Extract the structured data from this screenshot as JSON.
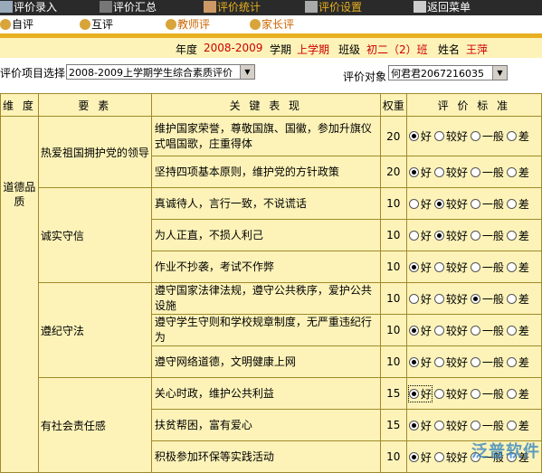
{
  "top_nav": [
    {
      "label": "评价录入",
      "color": "#ffffff",
      "icon": "pencil-icon"
    },
    {
      "label": "评价汇总",
      "color": "#ffffff",
      "icon": "computer-icon"
    },
    {
      "label": "评价统计",
      "color": "#e8b020",
      "icon": "chart-icon"
    },
    {
      "label": "评价设置",
      "color": "#e8b020",
      "icon": "tools-icon"
    },
    {
      "label": "返回菜单",
      "color": "#ffffff",
      "icon": "calculator-icon"
    }
  ],
  "sub_nav": [
    {
      "label": "自评",
      "color": "#000000",
      "icon": "person-icon"
    },
    {
      "label": "互评",
      "color": "#000000",
      "icon": "people-icon"
    },
    {
      "label": "教师评",
      "color": "#cc6600",
      "icon": "teacher-icon"
    },
    {
      "label": "家长评",
      "color": "#cc6600",
      "icon": "parent-icon"
    }
  ],
  "info": {
    "year_label": "年度",
    "year": "2008-2009",
    "term_label": "学期",
    "term": "上学期",
    "class_label": "班级",
    "class": "初二（2）班",
    "name_label": "姓名",
    "name": "王萍"
  },
  "selectors": {
    "project_label": "评价项目选择",
    "project_value": "2008-2009上学期学生综合素质评价",
    "target_label": "评价对象",
    "target_value": "何君君2067216035"
  },
  "table": {
    "headers": [
      "维 度",
      "要 素",
      "关 键 表 现",
      "权重",
      "评 价 标 准"
    ],
    "options": [
      "好",
      "较好",
      "一般",
      "差"
    ],
    "dimension": "道德品质",
    "groups": [
      {
        "element": "热爱祖国拥护党的领导",
        "rows": [
          {
            "text": "维护国家荣誉，尊敬国旗、国徽，参加升旗仪式唱国歌，庄重得体",
            "weight": "20",
            "selected": 0
          },
          {
            "text": "坚持四项基本原则，维护党的方针政策",
            "weight": "20",
            "selected": 0
          }
        ]
      },
      {
        "element": "诚实守信",
        "rows": [
          {
            "text": "真诚待人，言行一致，不说谎话",
            "weight": "10",
            "selected": 1
          },
          {
            "text": "为人正直，不损人利己",
            "weight": "10",
            "selected": 1
          },
          {
            "text": "作业不抄袭，考试不作弊",
            "weight": "10",
            "selected": 0
          }
        ]
      },
      {
        "element": "遵纪守法",
        "rows": [
          {
            "text": "遵守国家法律法规，遵守公共秩序，爱护公共设施",
            "weight": "10",
            "selected": 2
          },
          {
            "text": "遵守学生守则和学校规章制度，无严重违纪行为",
            "weight": "10",
            "selected": 0
          },
          {
            "text": "遵守网络道德，文明健康上网",
            "weight": "10",
            "selected": 0
          }
        ]
      },
      {
        "element": "有社会责任感",
        "rows": [
          {
            "text": "关心时政，维护公共利益",
            "weight": "15",
            "selected": 0
          },
          {
            "text": "扶贫帮困，富有爱心",
            "weight": "15",
            "selected": 0
          },
          {
            "text": "积极参加环保等实践活动",
            "weight": "10",
            "selected": 0
          }
        ]
      }
    ]
  },
  "watermark": "泛普软件"
}
